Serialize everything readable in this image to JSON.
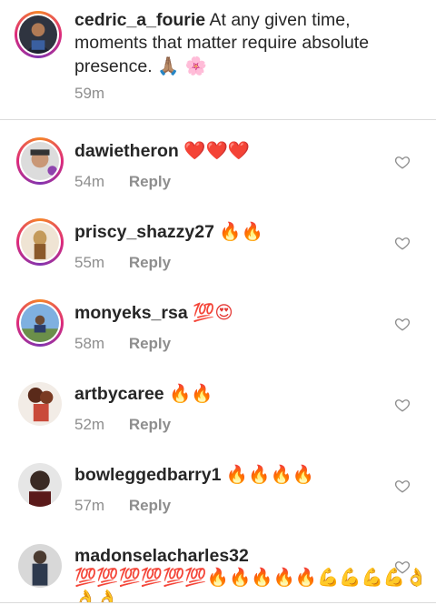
{
  "caption": {
    "username": "cedric_a_fourie",
    "text": "At any given time, moments that matter require absolute presence.",
    "emoji": "🙏🏽 🌸",
    "time": "59m"
  },
  "reply_label": "Reply",
  "comments": [
    {
      "username": "dawietheron",
      "text": "❤️❤️❤️",
      "time": "54m",
      "avatar_color": "#6d6d6d"
    },
    {
      "username": "priscy_shazzy27",
      "text": "🔥🔥",
      "time": "55m",
      "avatar_color": "#c9a36b"
    },
    {
      "username": "monyeks_rsa",
      "text": "💯😍",
      "time": "58m",
      "avatar_color": "#4e7fb7"
    },
    {
      "username": "artbycaree",
      "text": "🔥🔥",
      "time": "52m",
      "avatar_color": "#8a4a3a"
    },
    {
      "username": "bowleggedbarry1",
      "text": "🔥🔥🔥🔥",
      "time": "57m",
      "avatar_color": "#3a2c2a"
    },
    {
      "username": "madonselacharles32",
      "text": "💯💯💯💯💯💯🔥🔥🔥🔥🔥💪💪💪💪👌👌👌",
      "time": "",
      "avatar_color": "#5b5b5b"
    }
  ],
  "icons": {
    "like": "heart-outline-icon"
  }
}
